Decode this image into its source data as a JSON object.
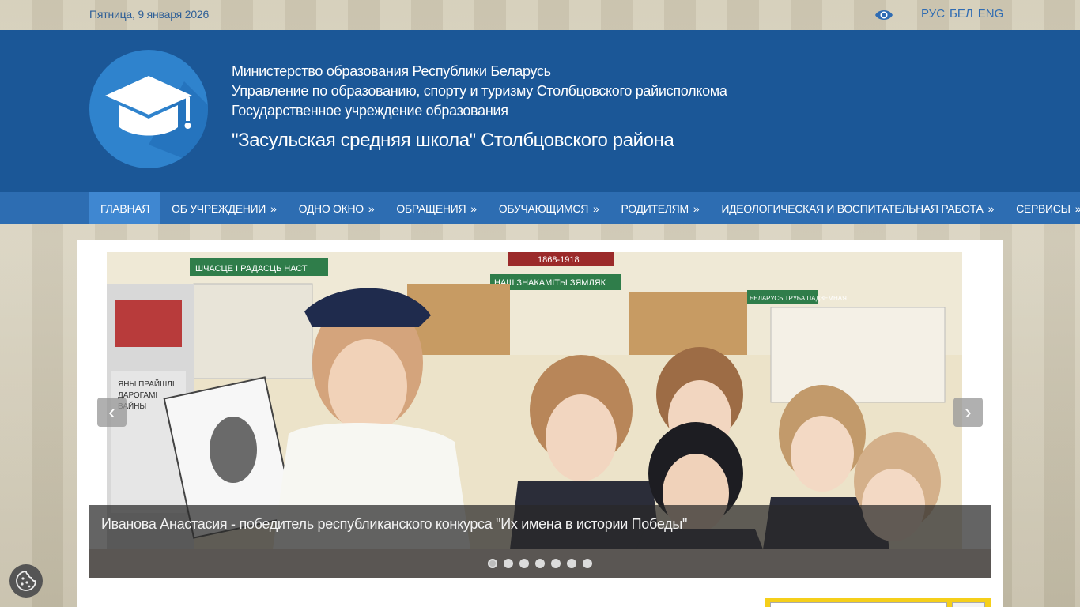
{
  "topbar": {
    "date": "Пятница, 9 января 2026",
    "languages": [
      "РУС",
      "БЕЛ",
      "ENG"
    ]
  },
  "header": {
    "line1": "Министерство образования Республики Беларусь",
    "line2": "Управление по образованию, спорту и туризму Столбцовского райисполкома",
    "line3": "Государственное учреждение образования",
    "school_name": "\"Засульская средняя школа\" Столбцовского района"
  },
  "nav": {
    "items": [
      {
        "label": "Главная",
        "arrow": ""
      },
      {
        "label": "Об учреждении",
        "arrow": "»"
      },
      {
        "label": "Одно окно",
        "arrow": "»"
      },
      {
        "label": "Обращения",
        "arrow": "»"
      },
      {
        "label": "Обучающимся",
        "arrow": "»"
      },
      {
        "label": "Родителям",
        "arrow": "»"
      },
      {
        "label": "Идеологическая и воспитательная работа",
        "arrow": "»"
      },
      {
        "label": "Сервисы",
        "arrow": "»"
      }
    ]
  },
  "slider": {
    "caption": "Иванова Анастасия - победитель республиканского конкурса \"Их имена в истории Победы\"",
    "prev_symbol": "‹",
    "next_symbol": "›",
    "slide_count": 7,
    "active_index": 0,
    "image_text": {
      "banner_left": "ШЧАСЦЕ І РАДАСЦЬ НАСТ",
      "banner_top": "1868-1918",
      "banner_mid": "НАШ ЗНАКАМІТЫ ЗЯМЛЯК",
      "banner_right": "БЕЛАРУСЬ ТРУБА ПАДЗЕМНАЯ",
      "book_1": "ЯНЫ ПРАЙШЛІ",
      "book_2": "ДАРОГАМІ",
      "book_3": "ВАЙНЫ"
    }
  },
  "colors": {
    "header_bg": "#1b5797",
    "nav_bg": "#2d6db2",
    "nav_active": "#3f87d1",
    "logo_bg": "#2f83cd",
    "search_accent": "#f5cf1a"
  },
  "icons": {
    "eye": "eye-icon",
    "logo": "graduation-cap-icon",
    "cookie": "cookie-icon"
  }
}
